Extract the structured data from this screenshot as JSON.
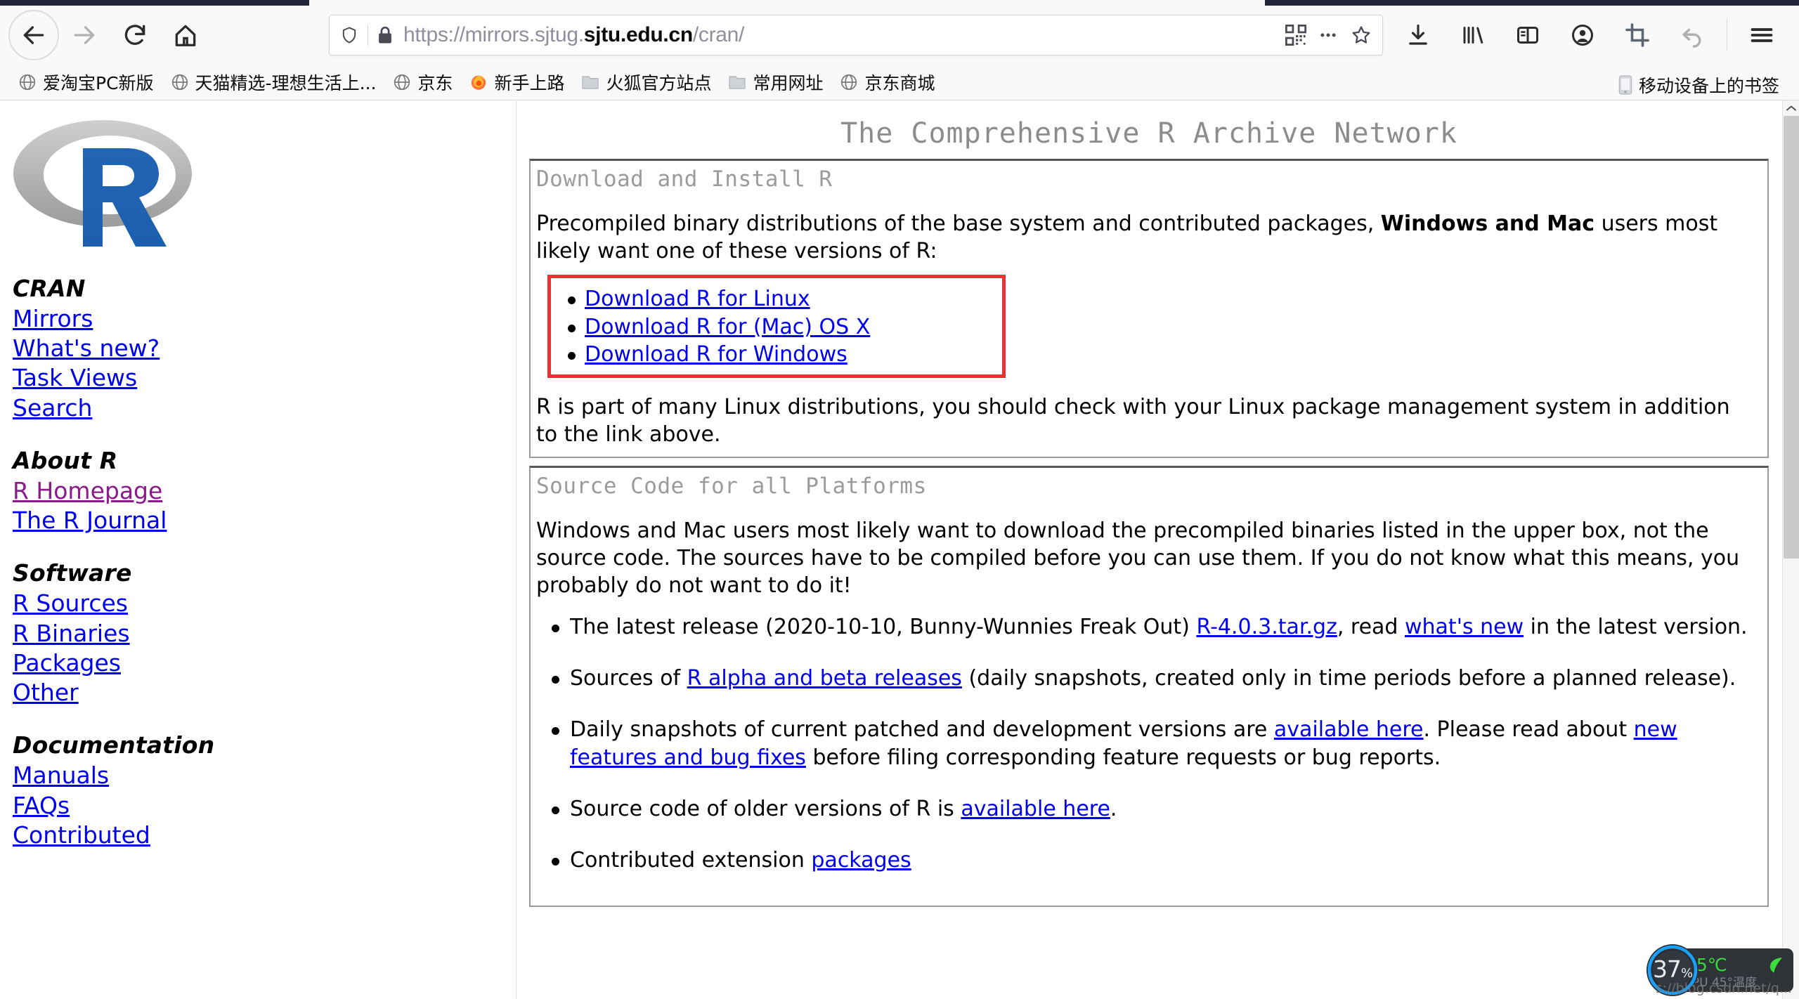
{
  "browser": {
    "nav": {
      "back_label": "Back",
      "forward_label": "Forward",
      "reload_label": "Reload",
      "home_label": "Home"
    },
    "urlbar": {
      "url_prefix": "https://mirrors.sjtug.",
      "url_domain": "sjtu.edu.cn",
      "url_suffix": "/cran/",
      "full_url": "https://mirrors.sjtug.sjtu.edu.cn/cran/",
      "shield_label": "Tracking protection",
      "lock_label": "Secure connection",
      "qr_label": "QR code",
      "more_label": "Page actions",
      "bookmark_label": "Bookmark this page"
    },
    "toolbar_right": [
      {
        "name": "downloads",
        "label": "Downloads"
      },
      {
        "name": "library",
        "label": "Library"
      },
      {
        "name": "sidebar",
        "label": "Sidebars"
      },
      {
        "name": "account",
        "label": "Account"
      },
      {
        "name": "screenshot",
        "label": "Take a screenshot"
      },
      {
        "name": "undo",
        "label": "Undo"
      },
      {
        "name": "menu",
        "label": "Open application menu"
      }
    ],
    "bookmarks": [
      {
        "label": "爱淘宝PC新版",
        "icon": "globe-icon"
      },
      {
        "label": "天猫精选-理想生活上...",
        "icon": "globe-icon"
      },
      {
        "label": "京东",
        "icon": "globe-icon"
      },
      {
        "label": "新手上路",
        "icon": "firefox-icon"
      },
      {
        "label": "火狐官方站点",
        "icon": "folder-icon"
      },
      {
        "label": "常用网址",
        "icon": "folder-icon"
      },
      {
        "label": "京东商城",
        "icon": "globe-icon"
      }
    ],
    "bookmarks_mobile": {
      "label": "移动设备上的书签",
      "icon": "phone-icon"
    }
  },
  "page": {
    "title": "The Comprehensive R Archive Network",
    "logo_alt": "R logo",
    "sidebar": [
      {
        "heading": "CRAN",
        "links": [
          {
            "label": "Mirrors",
            "visited": false
          },
          {
            "label": "What's new?",
            "visited": false
          },
          {
            "label": "Task Views",
            "visited": false
          },
          {
            "label": "Search",
            "visited": false
          }
        ]
      },
      {
        "heading": "About R",
        "links": [
          {
            "label": "R Homepage",
            "visited": true
          },
          {
            "label": "The R Journal",
            "visited": false
          }
        ]
      },
      {
        "heading": "Software",
        "links": [
          {
            "label": "R Sources",
            "visited": false
          },
          {
            "label": "R Binaries",
            "visited": false
          },
          {
            "label": "Packages",
            "visited": false
          },
          {
            "label": "Other",
            "visited": false
          }
        ]
      },
      {
        "heading": "Documentation",
        "links": [
          {
            "label": "Manuals",
            "visited": false
          },
          {
            "label": "FAQs",
            "visited": false
          },
          {
            "label": "Contributed",
            "visited": false
          }
        ]
      }
    ],
    "download_panel": {
      "heading": "Download and Install R",
      "intro_part1": "Precompiled binary distributions of the base system and contributed packages, ",
      "intro_bold": "Windows and Mac",
      "intro_part2": " users most likely want one of these versions of R:",
      "links": [
        "Download R for Linux",
        "Download R for (Mac) OS X",
        "Download R for Windows"
      ],
      "outro": "R is part of many Linux distributions, you should check with your Linux package management system in addition to the link above.",
      "highlight_color": "#f03030"
    },
    "source_panel": {
      "heading": "Source Code for all Platforms",
      "intro": "Windows and Mac users most likely want to download the precompiled binaries listed in the upper box, not the source code. The sources have to be compiled before you can use them. If you do not know what this means, you probably do not want to do it!",
      "bullets": [
        {
          "t1": "The latest release (2020-10-10, Bunny-Wunnies Freak Out) ",
          "a1": "R-4.0.3.tar.gz",
          "t2": ", read ",
          "a2": "what's new",
          "t3": " in the latest version."
        },
        {
          "t1": "Sources of ",
          "a1": "R alpha and beta releases",
          "t2": " (daily snapshots, created only in time periods before a planned release).",
          "a2": "",
          "t3": ""
        },
        {
          "t1": "Daily snapshots of current patched and development versions are ",
          "a1": "available here",
          "t2": ". Please read about ",
          "a2": "new features and bug fixes",
          "t3": " before filing corresponding feature requests or bug reports."
        },
        {
          "t1": "Source code of older versions of R is ",
          "a1": "available here",
          "t2": ".",
          "a2": "",
          "t3": ""
        },
        {
          "t1": "Contributed extension ",
          "a1": "packages",
          "t2": "",
          "a2": "",
          "t3": ""
        }
      ]
    }
  },
  "system_monitor": {
    "gauge_value": "37",
    "gauge_unit": "%",
    "temperature": "45℃",
    "sub_label": "CPU 45°温度",
    "gauge_color": "#18a0fb",
    "temp_color": "#36d93b"
  },
  "watermark": {
    "text": "s://blog.csdn.net/q..."
  }
}
